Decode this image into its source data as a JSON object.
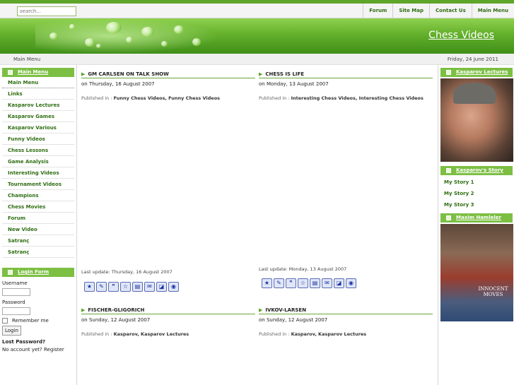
{
  "search": {
    "placeholder": "search..."
  },
  "topnav": [
    "Forum",
    "Site Map",
    "Contact Us",
    "Main Menu"
  ],
  "site_title": "Chess Videos",
  "breadcrumb": "Main Menu",
  "date": "Friday, 24 June 2011",
  "left": {
    "main_menu_title": "Main Menu",
    "menu": [
      "Main Menu",
      "Links",
      "Kasparov Lectures",
      "Kasparov Games",
      "Kasparov Various",
      "Funny Videos",
      "Chess Lessons",
      "Game Analysis",
      "Interesting Videos",
      "Tournament Videos",
      "Champions",
      "Chess Movies",
      "Forum",
      "New Video",
      "Satranç",
      "Satranç"
    ],
    "login": {
      "title": "Login Form",
      "username_label": "Username",
      "password_label": "Password",
      "remember_label": "Remember me",
      "login_button": "Login",
      "lost_password": "Lost Password?",
      "no_account": "No account yet? Register"
    }
  },
  "articles": [
    {
      "title": "GM CARLSEN ON TALK SHOW",
      "date": "on Thursday, 16 August 2007",
      "published_prefix": "Published in : ",
      "categories": "Funny Chess Videos, Funny Chess Videos",
      "last_update": "Last update: Thursday, 16 August 2007"
    },
    {
      "title": "CHESS IS LIFE",
      "date": "on Monday, 13 August 2007",
      "published_prefix": "Published in : ",
      "categories": "Interesting Chess Videos, Interesting Chess Videos",
      "last_update": "Last update: Monday, 13 August 2007"
    },
    {
      "title": "FISCHER-GLIGORICH",
      "date": "on Sunday, 12 August 2007",
      "published_prefix": "Published in : ",
      "categories": "Kasparov, Kasparov Lectures"
    },
    {
      "title": "IVKOV-LARSEN",
      "date": "on Sunday, 12 August 2007",
      "published_prefix": "Published in : ",
      "categories": "Kasparov, Kasparov Lectures"
    }
  ],
  "right": {
    "lectures_title": "Kasparov Lectures",
    "story_title": "Kasparov's Story",
    "story_items": [
      "My Story 1",
      "My Story 2",
      "My Story 3"
    ],
    "movie_title": "Maxim Hamleler",
    "movie_poster_text": "INNOCENT MOVES"
  },
  "share_icons": [
    "bookmark-star-icon",
    "comment-icon",
    "share-icon",
    "favorite-star-icon",
    "print-icon",
    "email-icon",
    "delicious-icon",
    "stumble-icon"
  ],
  "colors": {
    "accent": "#5fa52a",
    "link": "#2f6e12",
    "header_green": "#7cbf43"
  }
}
